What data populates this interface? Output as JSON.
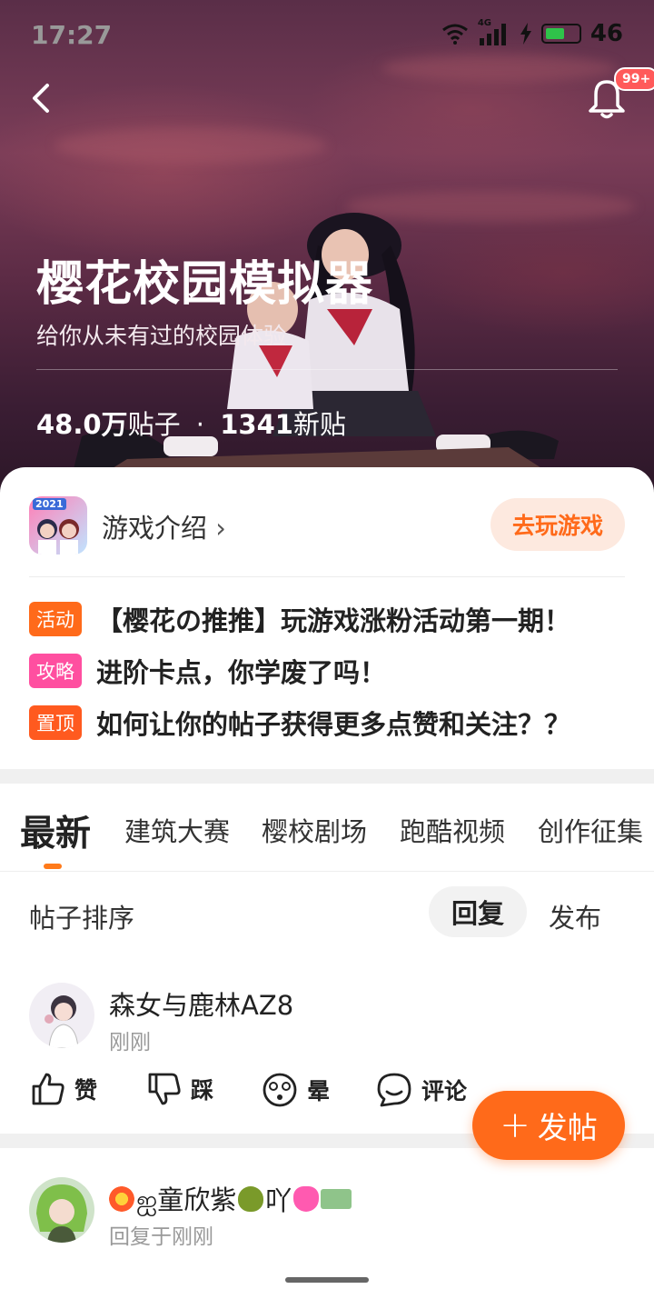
{
  "status_bar": {
    "time": "17:27",
    "network": "4G",
    "battery": "46"
  },
  "header": {
    "notification_badge": "99+"
  },
  "hero": {
    "title": "樱花校园模拟器",
    "subtitle": "给你从未有过的校园体验",
    "posts_count": "48.0万",
    "posts_label": "贴子",
    "separator": "·",
    "new_count": "1341",
    "new_label": "新贴"
  },
  "game": {
    "icon_year": "2021",
    "intro_label": "游戏介绍",
    "intro_chevron": "›",
    "play_label": "去玩游戏"
  },
  "notices": [
    {
      "tag": "活动",
      "tag_color": "#ff6a1a",
      "text": "【樱花の推推】玩游戏涨粉活动第一期！"
    },
    {
      "tag": "攻略",
      "tag_color": "#ff4fa0",
      "text": "进阶卡点，你学废了吗！"
    },
    {
      "tag": "置顶",
      "tag_color": "#ff5a1f",
      "text": "如何让你的帖子获得更多点赞和关注？？"
    }
  ],
  "tabs": [
    {
      "label": "最新",
      "active": true
    },
    {
      "label": "建筑大赛"
    },
    {
      "label": "樱校剧场"
    },
    {
      "label": "跑酷视频"
    },
    {
      "label": "创作征集"
    }
  ],
  "sort": {
    "label": "帖子排序",
    "options": [
      "回复",
      "发布"
    ],
    "selected": "回复"
  },
  "posts": [
    {
      "username": "森女与鹿林AZ8",
      "time": "刚刚",
      "actions": {
        "like": "赞",
        "dislike": "踩",
        "dizzy": "晕",
        "comment": "评论"
      }
    },
    {
      "username_prefix": "ஐ童欣紫",
      "username_suffix": "吖",
      "time": "回复于刚刚"
    }
  ],
  "fab": {
    "plus": "+",
    "label": "发帖"
  },
  "colors": {
    "accent": "#ff6a1a",
    "accent_bg": "#fde9df"
  }
}
